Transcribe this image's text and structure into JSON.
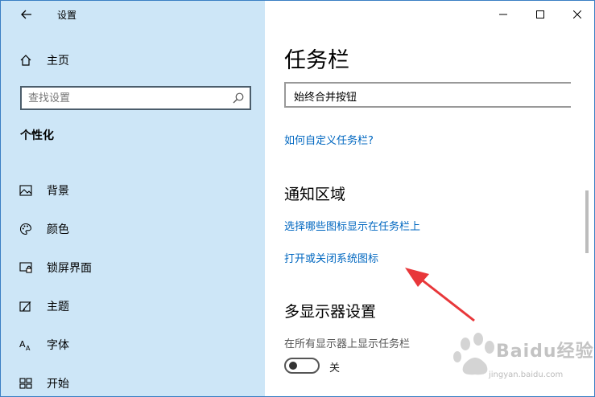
{
  "window": {
    "title": "设置",
    "controls": [
      "minimize-icon",
      "maximize-icon",
      "close-icon"
    ]
  },
  "sidebar": {
    "home_label": "主页",
    "search_placeholder": "查找设置",
    "section_title": "个性化",
    "items": [
      {
        "label": "背景",
        "icon": "image-icon"
      },
      {
        "label": "颜色",
        "icon": "palette-icon"
      },
      {
        "label": "锁屏界面",
        "icon": "lock-screen-icon"
      },
      {
        "label": "主题",
        "icon": "theme-icon"
      },
      {
        "label": "字体",
        "icon": "font-icon"
      },
      {
        "label": "开始",
        "icon": "start-icon"
      }
    ]
  },
  "main": {
    "title": "任务栏",
    "combine_buttons_value": "始终合并按钮",
    "customize_link": "如何自定义任务栏?",
    "notification_area": {
      "title": "通知区域",
      "link_select_icons": "选择哪些图标显示在任务栏上",
      "link_system_icons": "打开或关闭系统图标"
    },
    "multi_display": {
      "title": "多显示器设置",
      "show_on_all_label": "在所有显示器上显示任务栏",
      "toggle_state": "关"
    }
  },
  "watermark": {
    "brand": "Baidu经验",
    "url": "jingyan.baidu.com"
  },
  "colors": {
    "sidebar_bg": "#cde6f7",
    "link": "#0067c0",
    "annotation_arrow": "#e8373a"
  }
}
